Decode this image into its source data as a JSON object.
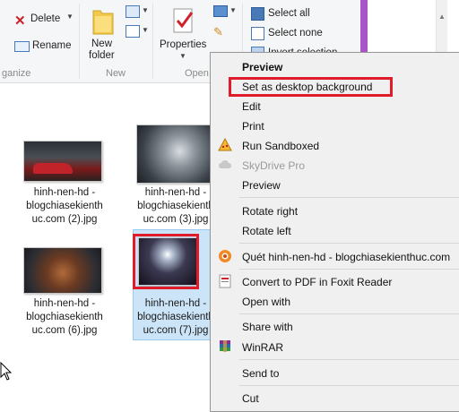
{
  "ribbon": {
    "organize": {
      "delete_label": "Delete",
      "rename_label": "Rename",
      "group_label": "ganize"
    },
    "new": {
      "new_folder_label_1": "New",
      "new_folder_label_2": "folder",
      "group_label": "New"
    },
    "open": {
      "properties_label": "Properties",
      "group_label": "Open"
    },
    "select": {
      "select_all": "Select all",
      "select_none": "Select none",
      "invert_selection": "Invert selection"
    }
  },
  "files": [
    {
      "line1": "hinh-nen-hd -",
      "line2": "blogchiasekienth",
      "line3": "uc.com (2).jpg"
    },
    {
      "line1": "hinh-nen-hd -",
      "line2": "blogchiasekienth",
      "line3": "uc.com (3).jpg"
    },
    {
      "line1": "hinh-nen-hd -",
      "line2": "blogchiasekienth",
      "line3": "uc.com (6).jpg"
    },
    {
      "line1": "hinh-nen-hd -",
      "line2": "blogchiasekienth",
      "line3": "uc.com (7).jpg"
    }
  ],
  "context_menu": {
    "preview_default": "Preview",
    "set_desktop_bg": "Set as desktop background",
    "edit": "Edit",
    "print": "Print",
    "run_sandboxed": "Run Sandboxed",
    "skydrive_pro": "SkyDrive Pro",
    "preview": "Preview",
    "rotate_right": "Rotate right",
    "rotate_left": "Rotate left",
    "quet": "Quét hinh-nen-hd - blogchiasekienthuc.com",
    "convert_pdf": "Convert to PDF in Foxit Reader",
    "open_with": "Open with",
    "share_with": "Share with",
    "winrar": "WinRAR",
    "send_to": "Send to",
    "cut": "Cut"
  },
  "colors": {
    "highlight_red": "#e01c2a",
    "selection_bg": "#cce4f7",
    "accent_purple": "#a855c8"
  }
}
